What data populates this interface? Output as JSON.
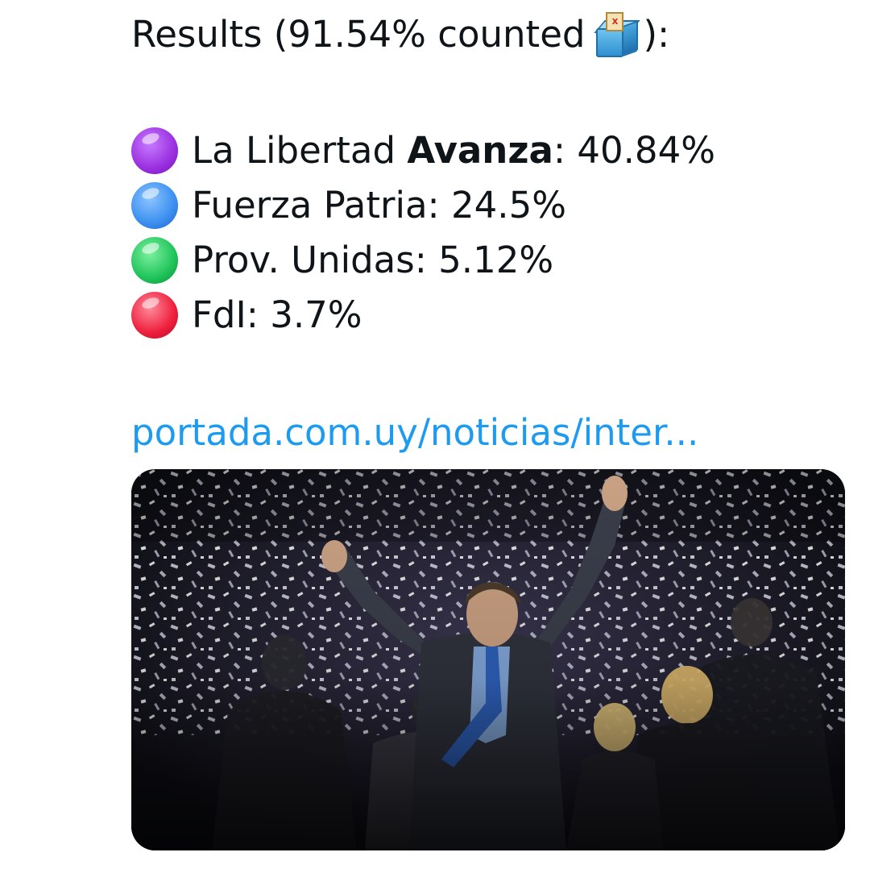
{
  "tweet": {
    "header_prefix": "Results (91.54% counted",
    "header_suffix": "):",
    "ballot_icon": "ballot-box-icon",
    "ballot_mark": "x",
    "parties": [
      {
        "name_regular": "La Libertad ",
        "name_bold": "Avanza",
        "result": ": 40.84%",
        "dot_color": "#9b2fe0",
        "icon": "purple-circle-icon"
      },
      {
        "name_regular": "Fuerza Patria",
        "name_bold": "",
        "result": ": 24.5%",
        "dot_color": "#3b8ff0",
        "icon": "blue-circle-icon"
      },
      {
        "name_regular": "Prov. Unidas",
        "name_bold": "",
        "result": ": 5.12%",
        "dot_color": "#1fc45a",
        "icon": "green-circle-icon"
      },
      {
        "name_regular": "FdI",
        "name_bold": "",
        "result": ": 3.7%",
        "dot_color": "#ee1f3c",
        "icon": "red-circle-icon"
      }
    ],
    "link_text": "portada.com.uy/noticias/inter..."
  },
  "colors": {
    "text": "#0f1419",
    "link": "#1d9bf0",
    "media_background": "#14151c"
  }
}
